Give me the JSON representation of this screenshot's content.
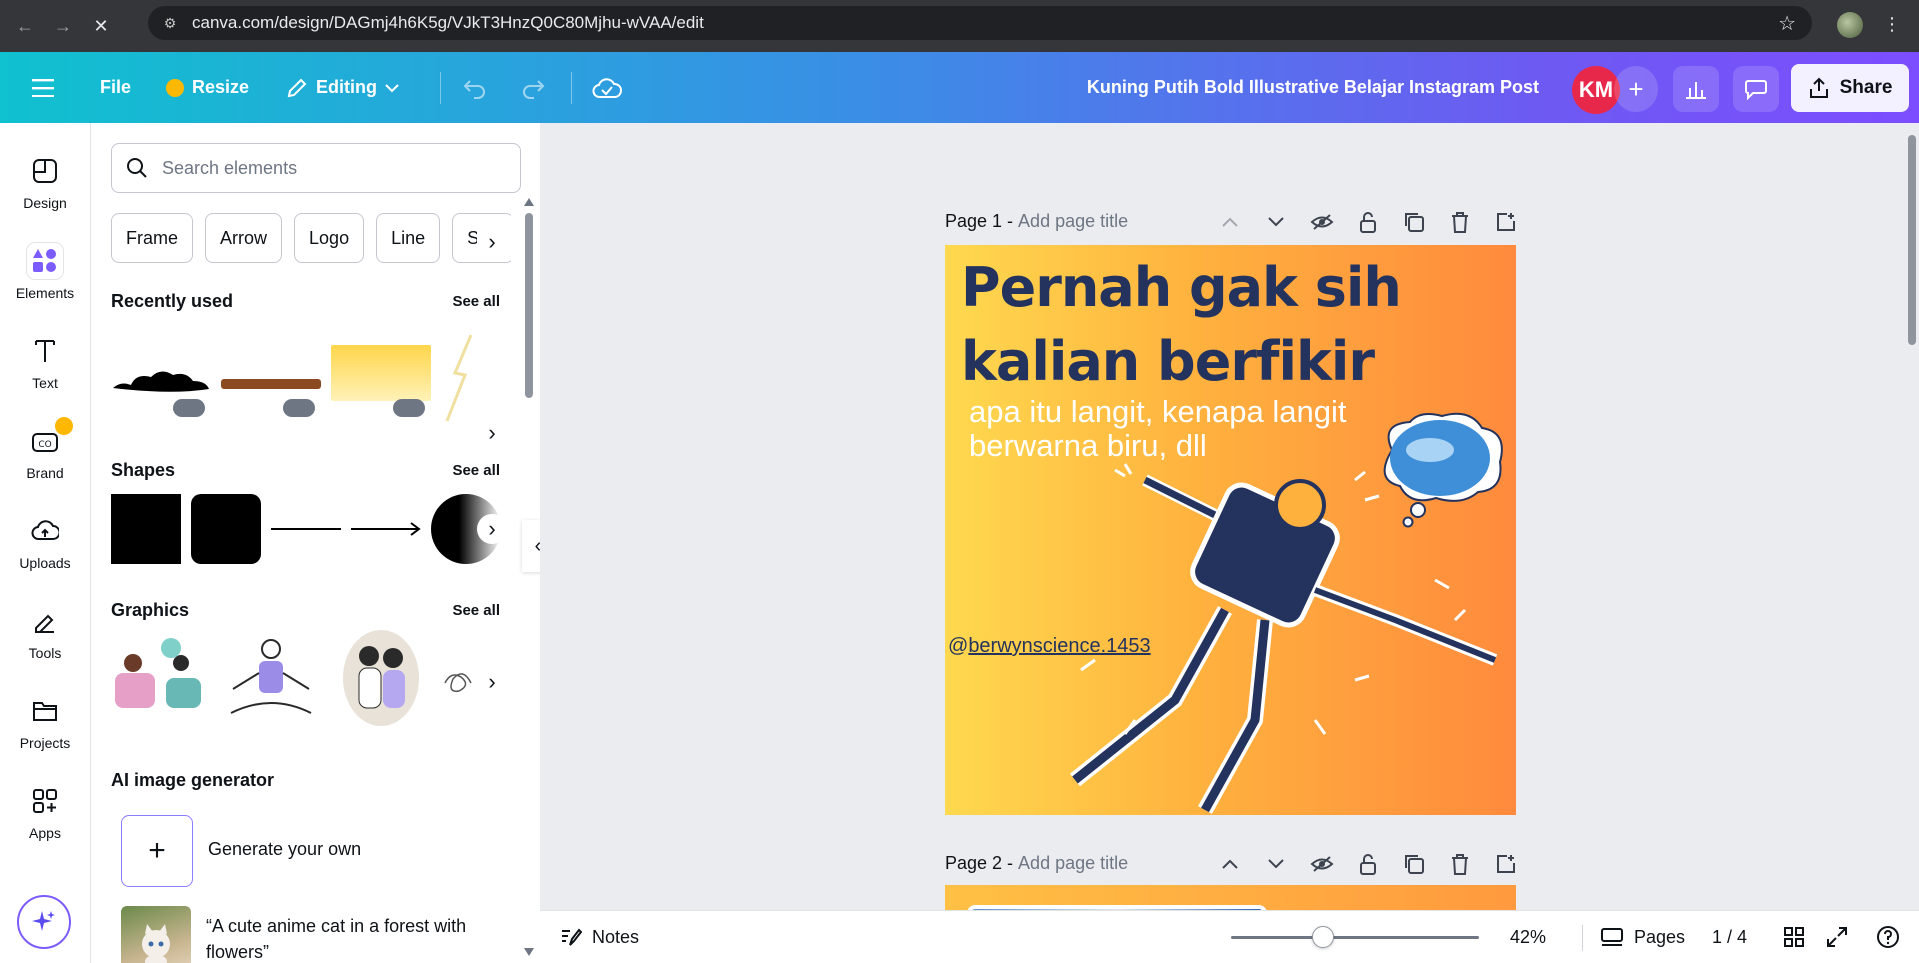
{
  "browser": {
    "url": "canva.com/design/DAGmj4h6K5g/VJkT3HnzQ0C80Mjhu-wVAA/edit"
  },
  "topbar": {
    "file_label": "File",
    "resize_label": "Resize",
    "editing_label": "Editing",
    "title": "Kuning Putih Bold Illustrative Belajar Instagram Post",
    "avatar_initials": "KM",
    "share_label": "Share"
  },
  "rail": {
    "items": [
      {
        "label": "Design",
        "icon": "design-icon"
      },
      {
        "label": "Elements",
        "icon": "elements-icon"
      },
      {
        "label": "Text",
        "icon": "text-icon"
      },
      {
        "label": "Brand",
        "icon": "brand-icon"
      },
      {
        "label": "Uploads",
        "icon": "uploads-icon"
      },
      {
        "label": "Tools",
        "icon": "tools-icon"
      },
      {
        "label": "Projects",
        "icon": "projects-icon"
      },
      {
        "label": "Apps",
        "icon": "apps-icon"
      }
    ]
  },
  "panel": {
    "search_placeholder": "Search elements",
    "chips": [
      "Frame",
      "Arrow",
      "Logo",
      "Line",
      "Sha"
    ],
    "recently_used": {
      "title": "Recently used",
      "see_all": "See all"
    },
    "shapes": {
      "title": "Shapes",
      "see_all": "See all"
    },
    "graphics": {
      "title": "Graphics",
      "see_all": "See all"
    },
    "ai_generator": {
      "title": "AI image generator",
      "generate_label": "Generate your own",
      "prompt_text": "“A cute anime cat in a forest with flowers”"
    }
  },
  "canvas": {
    "page1": {
      "label": "Page 1 -",
      "title_placeholder": "Add page title"
    },
    "page2": {
      "label": "Page 2 -",
      "title_placeholder": "Add page title"
    },
    "design": {
      "headline_line1": "Pernah gak sih",
      "headline_line2": "kalian berfikir",
      "subline": "apa itu langit, kenapa langit berwarna biru, dll",
      "handle_prefix": "@",
      "handle": "berwynscience.1453"
    }
  },
  "bottombar": {
    "notes_label": "Notes",
    "zoom": "42%",
    "pages_label": "Pages",
    "page_count": "1 / 4"
  },
  "colors": {
    "accent": "#7d5cff",
    "headline": "#24335e",
    "avatar": "#e8284a"
  }
}
